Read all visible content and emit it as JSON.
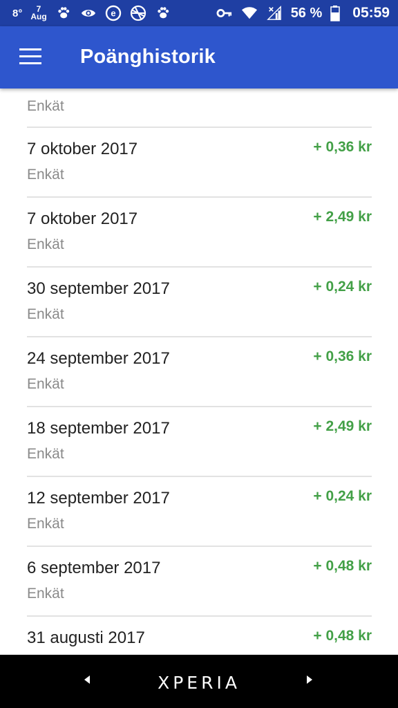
{
  "status_bar": {
    "temperature": "8°",
    "date_day": "7",
    "date_month": "Aug",
    "battery_percent": "56 %",
    "time": "05:59",
    "icons": [
      "paw-icon",
      "eye-icon",
      "e-icon",
      "globe-icon",
      "paw-icon",
      "key-icon",
      "wifi-icon",
      "signal-icon",
      "battery-icon"
    ]
  },
  "app_bar": {
    "title": "Poänghistorik",
    "menu_icon": "hamburger-menu-icon"
  },
  "history": {
    "partial_type": "Enkät",
    "items": [
      {
        "date": "7 oktober 2017",
        "type": "Enkät",
        "amount": "+ 0,36 kr"
      },
      {
        "date": "7 oktober 2017",
        "type": "Enkät",
        "amount": "+ 2,49 kr"
      },
      {
        "date": "30 september 2017",
        "type": "Enkät",
        "amount": "+ 0,24 kr"
      },
      {
        "date": "24 september 2017",
        "type": "Enkät",
        "amount": "+ 0,36 kr"
      },
      {
        "date": "18 september 2017",
        "type": "Enkät",
        "amount": "+ 2,49 kr"
      },
      {
        "date": "12 september 2017",
        "type": "Enkät",
        "amount": "+ 0,24 kr"
      },
      {
        "date": "6 september 2017",
        "type": "Enkät",
        "amount": "+ 0,48 kr"
      },
      {
        "date": "31 augusti 2017",
        "type": "",
        "amount": "+ 0,48 kr"
      }
    ]
  },
  "nav_bar": {
    "brand": "XPERIA"
  },
  "colors": {
    "status_bar": "#1f3fa3",
    "app_bar": "#2e56cd",
    "amount_green": "#43a047",
    "secondary_text": "#8a8a8a"
  }
}
